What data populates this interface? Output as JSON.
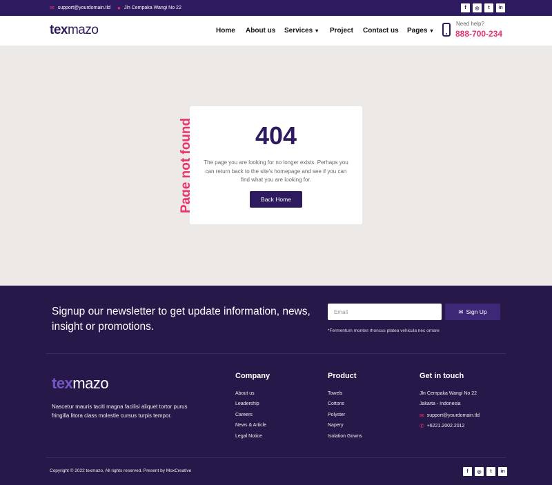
{
  "topbar": {
    "email": "support@yourdomain.tld",
    "address": "Jln Cempaka Wangi No 22",
    "social": [
      "f",
      "ig",
      "tw",
      "in"
    ]
  },
  "header": {
    "logo_a": "tex",
    "logo_b": "mazo",
    "nav": [
      "Home",
      "About us",
      "Services",
      "Project",
      "Contact us",
      "Pages"
    ],
    "help_label": "Need help?",
    "help_phone": "888-700-234"
  },
  "error": {
    "side_text": "Page not found",
    "code": "404",
    "message": "The page you are looking for no longer exists. Perhaps you can return back to the site's homepage and see if you can find what you are looking for.",
    "button": "Back Home"
  },
  "newsletter": {
    "title": "Signup our newsletter to get update information, news, insight or promotions.",
    "placeholder": "Email",
    "button": "Sign Up",
    "note": "*Fermentum montes rhoncus platea vehicula nec ornare"
  },
  "footer": {
    "logo_a": "tex",
    "logo_b": "mazo",
    "about": "Nascetur mauris taciti magna facilisi aliquet tortor purus fringilla litora class molestie cursus turpis tempor.",
    "company": {
      "title": "Company",
      "items": [
        "About us",
        "Leadership",
        "Careers",
        "News & Article",
        "Legal Notice"
      ]
    },
    "product": {
      "title": "Product",
      "items": [
        "Towels",
        "Cottons",
        "Polyster",
        "Napery",
        "Isolation Gowns"
      ]
    },
    "contact": {
      "title": "Get in touch",
      "address1": "Jln Cempaka Wangi No 22",
      "address2": "Jakarta - Indonesia",
      "email": "support@yourdomain.tld",
      "phone": "+6221.2002.2012"
    },
    "copyright": "Copyright © 2022 texmazo, All rights reserved. Present by MoxCreative"
  },
  "colors": {
    "primary": "#2e1a5e",
    "accent": "#e8336d",
    "footer_bg": "#261848",
    "page_bg": "#ede9e6"
  },
  "icons": {
    "envelope": "envelope-icon",
    "map_pin": "map-pin-icon",
    "phone": "phone-icon",
    "chevron": "chevron-down-icon"
  }
}
